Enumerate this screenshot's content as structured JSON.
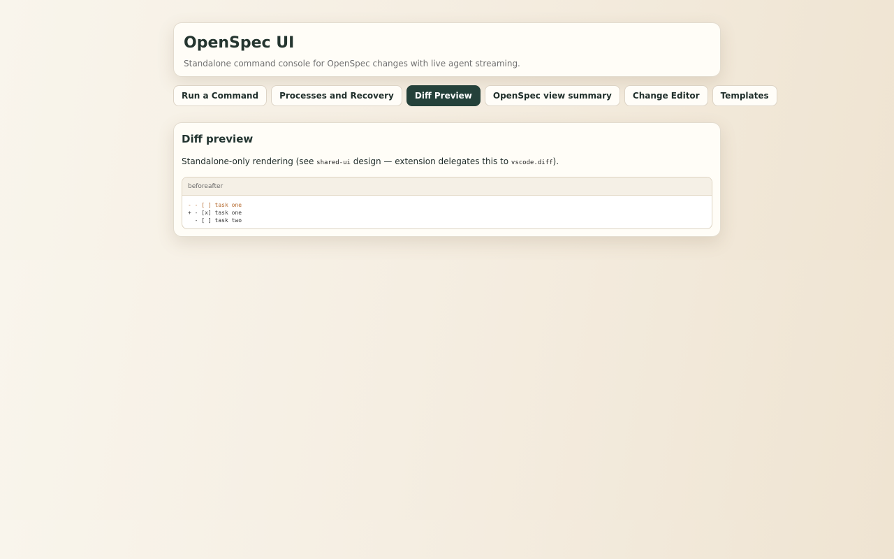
{
  "app": {
    "title": "OpenSpec UI",
    "subtitle": "Standalone command console for OpenSpec changes with live agent streaming."
  },
  "tabs": [
    {
      "label": "Run a Command",
      "active": false
    },
    {
      "label": "Processes and Recovery",
      "active": false
    },
    {
      "label": "Diff Preview",
      "active": true
    },
    {
      "label": "OpenSpec view summary",
      "active": false
    },
    {
      "label": "Change Editor",
      "active": false
    },
    {
      "label": "Templates",
      "active": false
    }
  ],
  "panel": {
    "title": "Diff preview",
    "description": {
      "part1": "Standalone-only rendering (see ",
      "code1": "shared-ui",
      "part2": " design — extension delegates this to ",
      "code2": "vscode.diff",
      "part3": ")."
    },
    "diff": {
      "header": "beforeafter",
      "lines": [
        {
          "type": "del",
          "text": "- - [ ] task one"
        },
        {
          "type": "add",
          "text": "+ - [x] task one"
        },
        {
          "type": "ctx",
          "text": "  - [ ] task two"
        }
      ]
    }
  },
  "colors": {
    "accent": "#24413a",
    "deletion": "#b56a2e",
    "card_background": "#fffdf7"
  }
}
